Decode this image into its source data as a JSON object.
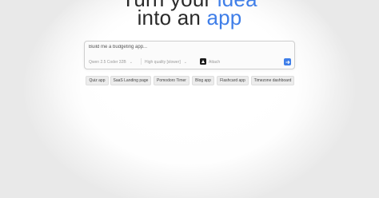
{
  "headline": {
    "line1_pre": "Turn your ",
    "line1_accent": "idea",
    "line2_pre": "into an ",
    "line2_accent": "app"
  },
  "prompt": {
    "placeholder": "Build me a budgeting app...",
    "model": "Qwen 2.5 Coder 32B",
    "quality": "High quality [slower]",
    "attach_label": "Attach"
  },
  "icons": {
    "model_dropdown": "chevron-down-icon",
    "quality_dropdown": "chevron-down-icon",
    "logo": "together-logo-icon",
    "send": "arrow-right-icon"
  },
  "colors": {
    "accent": "#3f7ee8",
    "text": "#2a2a2a",
    "logo_bg": "#1b1b1b"
  },
  "suggestions": [
    "Quiz app",
    "SaaS Landing page",
    "Pomodoro Timer",
    "Blog app",
    "Flashcard app",
    "Timezone dashboard"
  ]
}
